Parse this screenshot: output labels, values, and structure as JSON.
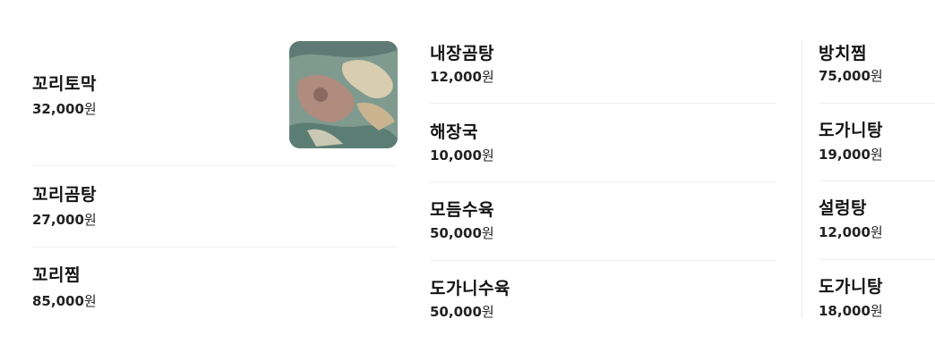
{
  "menu": {
    "currency_unit": "원",
    "columns": [
      {
        "items": [
          {
            "name": "꼬리토막",
            "price": "32,000",
            "has_image": true,
            "image_icon": "food-photo"
          },
          {
            "name": "꼬리곰탕",
            "price": "27,000"
          },
          {
            "name": "꼬리찜",
            "price": "85,000"
          }
        ]
      },
      {
        "items": [
          {
            "name": "내장곰탕",
            "price": "12,000"
          },
          {
            "name": "해장국",
            "price": "10,000"
          },
          {
            "name": "모듬수육",
            "price": "50,000"
          },
          {
            "name": "도가니수육",
            "price": "50,000"
          }
        ]
      },
      {
        "items": [
          {
            "name": "방치찜",
            "price": "75,000"
          },
          {
            "name": "도가니탕",
            "price": "19,000"
          },
          {
            "name": "설렁탕",
            "price": "12,000"
          },
          {
            "name": "도가니탕",
            "price": "18,000"
          }
        ]
      }
    ]
  },
  "colors": {
    "text_primary": "#111111",
    "divider": "#efefef",
    "background": "#ffffff"
  }
}
